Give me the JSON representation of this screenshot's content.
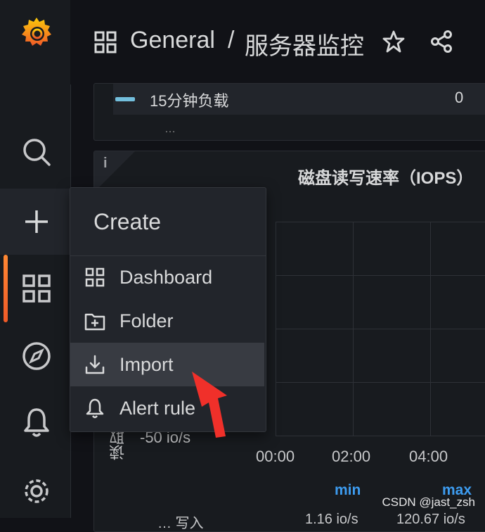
{
  "breadcrumb": {
    "folder": "General",
    "separator": "/",
    "dashboard": "服务器监控"
  },
  "panel_top": {
    "legend_label": "15分钟负载",
    "legend_value": "0",
    "cut_text": "…"
  },
  "panel_disk": {
    "info_glyph": "i",
    "title": "磁盘读写速率（IOPS）",
    "y_tick": "-50 io/s",
    "y_axis_label": "读取",
    "x_ticks": [
      "00:00",
      "02:00",
      "04:00"
    ],
    "legend_headers": {
      "min": "min",
      "max": "max"
    },
    "bottom_row": {
      "name": "… 写入",
      "min": "1.16 io/s",
      "max": "120.67 io/s"
    }
  },
  "create_menu": {
    "title": "Create",
    "items": [
      {
        "label": "Dashboard",
        "icon": "apps-icon"
      },
      {
        "label": "Folder",
        "icon": "folder-plus-icon"
      },
      {
        "label": "Import",
        "icon": "import-icon"
      },
      {
        "label": "Alert rule",
        "icon": "bell-icon"
      }
    ]
  },
  "colors": {
    "accent": "#f05a28",
    "legend_blue": "#73bfdd",
    "header_blue": "#3d9cf0",
    "arrow_red": "#f0302a"
  },
  "watermark": "CSDN @jast_zsh"
}
